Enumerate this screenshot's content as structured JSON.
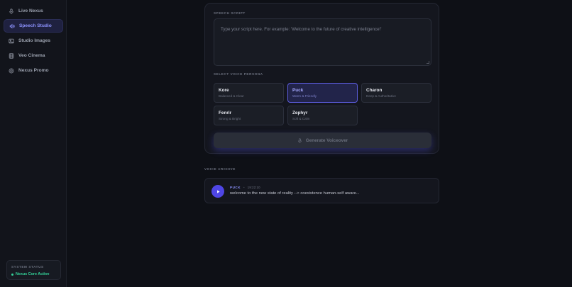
{
  "sidebar": {
    "items": [
      {
        "label": "Live Nexus",
        "icon": "microphone-icon",
        "active": false
      },
      {
        "label": "Speech Studio",
        "icon": "speaker-icon",
        "active": true
      },
      {
        "label": "Studio Images",
        "icon": "image-icon",
        "active": false
      },
      {
        "label": "Veo Cinema",
        "icon": "film-icon",
        "active": false
      },
      {
        "label": "Nexus Promo",
        "icon": "target-icon",
        "active": false
      }
    ],
    "status": {
      "title": "SYSTEM STATUS",
      "text": "Nexus Core Active",
      "color": "#34d399"
    }
  },
  "speech": {
    "script_label": "SPEECH SCRIPT",
    "script_placeholder": "Type your script here. For example: 'Welcome to the future of creative intelligence!'",
    "persona_label": "SELECT VOICE PERSONA",
    "personas": [
      {
        "name": "Kore",
        "desc": "Balanced & Clear",
        "selected": false
      },
      {
        "name": "Puck",
        "desc": "Warm & Friendly",
        "selected": true
      },
      {
        "name": "Charon",
        "desc": "Deep & Authoritative",
        "selected": false
      },
      {
        "name": "Fenrir",
        "desc": "Strong & Bright",
        "selected": false
      },
      {
        "name": "Zephyr",
        "desc": "Soft & Calm",
        "selected": false
      }
    ],
    "generate_label": "Generate Voiceover"
  },
  "archive": {
    "label": "VOICE ARCHIVE",
    "items": [
      {
        "voice": "PUCK",
        "separator": "•",
        "time": "19:22:10",
        "text": "welcome to the new state of reality --> coexistence human-self aware..."
      }
    ]
  },
  "colors": {
    "accent": "#4f46e5",
    "accent_text": "#8d93ff",
    "background": "#0e1016"
  }
}
